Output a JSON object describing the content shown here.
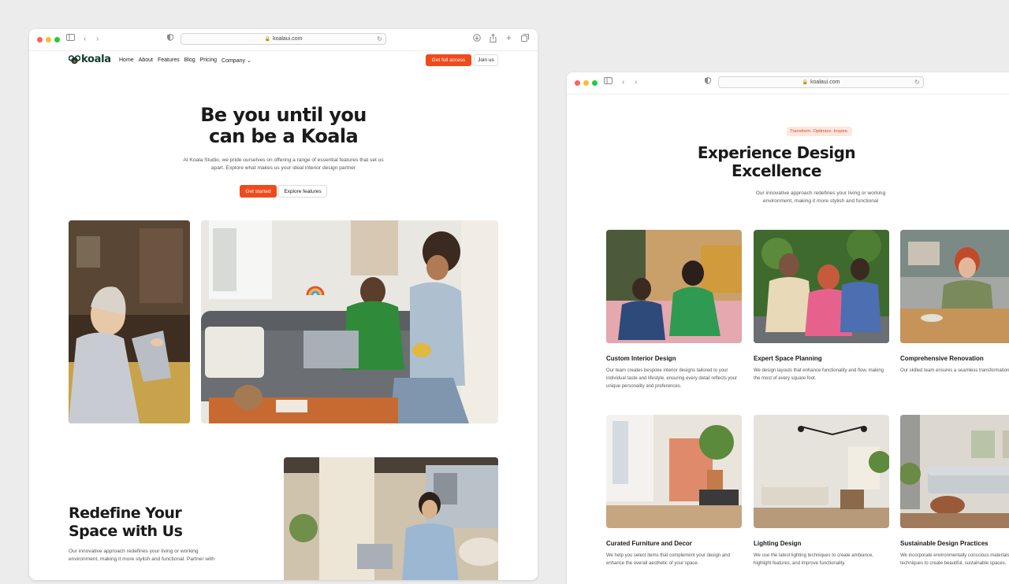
{
  "colors": {
    "accent": "#f04a1c",
    "brand": "#0f3d2e",
    "pill_bg": "#fde7e1"
  },
  "window_a": {
    "url": "koalaui.com",
    "nav": {
      "logo": "koala",
      "links": [
        "Home",
        "About",
        "Features",
        "Blog",
        "Pricing",
        "Company"
      ],
      "company_chevron": "⌄",
      "cta_primary": "Get full access",
      "cta_secondary": "Join us"
    },
    "hero": {
      "title_line1": "Be you until you",
      "title_line2": "can be a Koala",
      "subtitle": "At Koala Studio, we pride ourselves on offering a range of essential features that set us apart. Explore what makes us your ideal interior design partner",
      "btn_primary": "Get started",
      "btn_secondary": "Explore features"
    },
    "section": {
      "title_line1": "Redefine Your",
      "title_line2": "Space with Us",
      "body": "Our innovative approach redefines your living or working environment, making it more stylish and functional. Partner with"
    }
  },
  "window_b": {
    "url": "koalaui.com",
    "pill": "Transform. Optimize. Inspire.",
    "title_line1": "Experience Design",
    "title_line2": "Excellence",
    "subtitle": "Our innovative approach redefines your living or working environment, making it more stylish and functional",
    "cards": [
      {
        "title": "Custom Interior Design",
        "desc": "Our team creates bespoke interior designs tailored to your individual taste and lifestyle, ensuring every detail reflects your unique personality and preferences."
      },
      {
        "title": "Expert Space Planning",
        "desc": "We design layouts that enhance functionality and flow, making the most of every square foot."
      },
      {
        "title": "Comprehensive Renovation",
        "desc": "Our skilled team ensures a seamless transformation that revitalizes your space."
      },
      {
        "title": "Curated Furniture and Decor",
        "desc": "We help you select items that complement your design and enhance the overall aesthetic of your space."
      },
      {
        "title": "Lighting Design",
        "desc": "We use the latest lighting techniques to create ambiance, highlight features, and improve functionality."
      },
      {
        "title": "Sustainable Design Practices",
        "desc": "We incorporate environmentally conscious materials and techniques to create beautiful, sustainable spaces."
      }
    ]
  }
}
